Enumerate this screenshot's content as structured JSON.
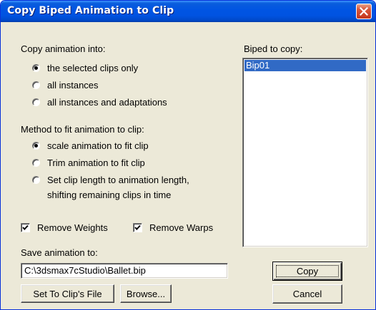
{
  "window": {
    "title": "Copy Biped Animation to Clip"
  },
  "copy_into": {
    "label": "Copy animation into:",
    "options": [
      {
        "label": "the selected clips only",
        "checked": true
      },
      {
        "label": "all instances",
        "checked": false
      },
      {
        "label": "all instances and adaptations",
        "checked": false
      }
    ]
  },
  "fit_method": {
    "label": "Method to fit animation to clip:",
    "options": [
      {
        "label": "scale animation to fit clip",
        "checked": true
      },
      {
        "label": "Trim animation to fit clip",
        "checked": false
      },
      {
        "label": "Set clip length to animation length,",
        "label_line2": "shifting remaining clips in time",
        "checked": false
      }
    ]
  },
  "checkboxes": {
    "remove_weights": {
      "label": "Remove Weights",
      "checked": true
    },
    "remove_warps": {
      "label": "Remove Warps",
      "checked": true
    }
  },
  "save": {
    "label": "Save animation to:",
    "path": "C:\\3dsmax7cStudio\\Ballet.bip",
    "set_to_clip_label": "Set To Clip's File",
    "browse_label": "Browse..."
  },
  "biped": {
    "label": "Biped to copy:",
    "items": [
      "Bip01"
    ],
    "selected": "Bip01"
  },
  "actions": {
    "copy_label": "Copy",
    "cancel_label": "Cancel"
  }
}
